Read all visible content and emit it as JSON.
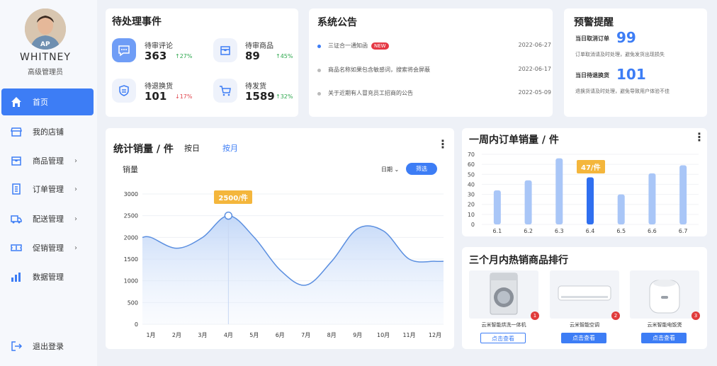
{
  "user": {
    "name": "WHITNEY",
    "role": "高级管理员"
  },
  "nav": [
    {
      "label": "首页",
      "icon": "home-icon",
      "active": true,
      "arrow": ""
    },
    {
      "label": "我的店铺",
      "icon": "store-icon",
      "arrow": ""
    },
    {
      "label": "商品管理",
      "icon": "product-icon",
      "arrow": "›"
    },
    {
      "label": "订单管理",
      "icon": "order-icon",
      "arrow": "›"
    },
    {
      "label": "配送管理",
      "icon": "truck-icon",
      "arrow": "›"
    },
    {
      "label": "促销管理",
      "icon": "ticket-icon",
      "arrow": "›"
    },
    {
      "label": "数据管理",
      "icon": "data-icon",
      "arrow": ""
    }
  ],
  "logout": "退出登录",
  "pending": {
    "title": "待处理事件",
    "items": [
      {
        "label": "待审评论",
        "value": "363",
        "change": "↑27%",
        "dir": "up"
      },
      {
        "label": "待审商品",
        "value": "89",
        "change": "↑45%",
        "dir": "up"
      },
      {
        "label": "待退换货",
        "value": "101",
        "change": "↓17%",
        "dir": "down"
      },
      {
        "label": "待发货",
        "value": "1589",
        "change": "↑32%",
        "dir": "up"
      }
    ]
  },
  "announce": {
    "title": "系统公告",
    "badge": "NEW",
    "items": [
      {
        "text": "三证合一通知函",
        "date": "2022-06-27"
      },
      {
        "text": "商品名称如果包含敏感词，搜索将会屏蔽",
        "date": "2022-06-17"
      },
      {
        "text": "关于近期有人冒充员工招商的公告",
        "date": "2022-05-09"
      }
    ]
  },
  "warning": {
    "title": "预警提醒",
    "items": [
      {
        "label": "当日取消订单",
        "value": "99",
        "desc": "订单取消请及时处理，避免发货出现损失"
      },
      {
        "label": "当日待退换货",
        "value": "101",
        "desc": "退换货请及时处理，避免导致用户体验不佳"
      }
    ]
  },
  "sales": {
    "title": "统计销量 / 件",
    "tab_day": "按日",
    "tab_month": "按月",
    "ylabel": "销量",
    "date_select": "日期",
    "filter_button": "筛选",
    "tooltip": "2500/件"
  },
  "weekly": {
    "title": "一周内订单销量 / 件",
    "tooltip": "47/件"
  },
  "hot": {
    "title": "三个月内热销商品排行",
    "button": "点击查看",
    "items": [
      {
        "rank": "1",
        "name": "云米智能烘洗一体机",
        "icon": "washing-machine-icon"
      },
      {
        "rank": "2",
        "name": "云米智能空调",
        "icon": "air-conditioner-icon"
      },
      {
        "rank": "3",
        "name": "云米智能电饭煲",
        "icon": "rice-cooker-icon"
      }
    ]
  },
  "chart_data": [
    {
      "type": "area",
      "title": "统计销量 / 件",
      "ylabel": "销量",
      "x": [
        "1月",
        "2月",
        "3月",
        "4月",
        "5月",
        "6月",
        "7月",
        "8月",
        "9月",
        "10月",
        "11月",
        "12月"
      ],
      "y": [
        2000,
        1750,
        2000,
        2500,
        2000,
        1250,
        900,
        1450,
        2200,
        2150,
        1500,
        1450
      ],
      "ylim": [
        0,
        3000
      ],
      "yticks": [
        0,
        500,
        1000,
        1500,
        2000,
        2500,
        3000
      ],
      "highlight": {
        "x": "4月",
        "y": 2500
      },
      "grid": true,
      "color": "#5b8fe0"
    },
    {
      "type": "bar",
      "title": "一周内订单销量 / 件",
      "categories": [
        "6.1",
        "6.2",
        "6.3",
        "6.4",
        "6.5",
        "6.6",
        "6.7"
      ],
      "values": [
        34,
        44,
        66,
        47,
        30,
        51,
        59
      ],
      "ylim": [
        0,
        70
      ],
      "yticks": [
        0,
        10,
        20,
        30,
        40,
        50,
        60,
        70
      ],
      "highlight": {
        "category": "6.4",
        "value": 47
      },
      "colors": {
        "bar": "#a9c6f7",
        "highlight": "#2f6ff0"
      }
    }
  ]
}
